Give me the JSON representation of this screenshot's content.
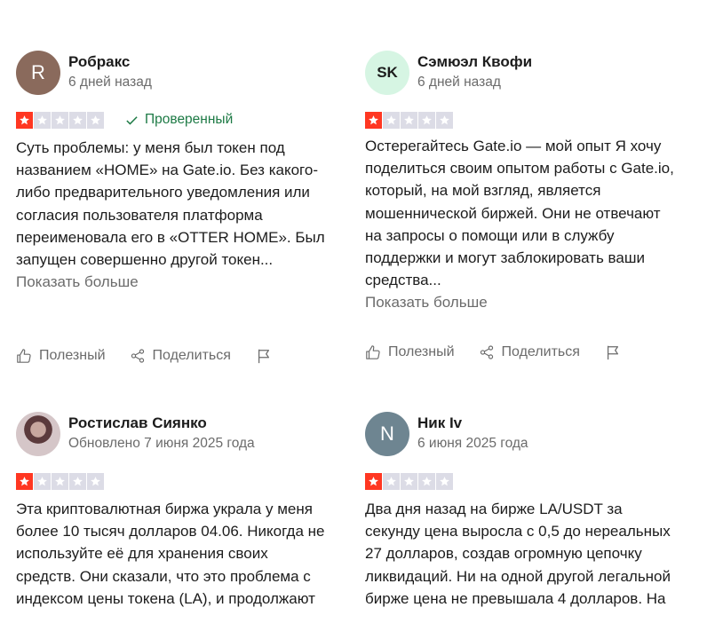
{
  "reviews": [
    {
      "name": "Робракс",
      "avatar_text": "R",
      "date": "6 дней назад",
      "rating": 1,
      "verified_label": "Проверенный",
      "text": "Суть проблемы: у меня был токен под названием «HOME» на Gate.io. Без какого-либо предварительного уведомления или согласия пользователя платформа переименовала его в «OTTER HOME». Был запущен совершенно другой токен...",
      "more_label": "Показать больше"
    },
    {
      "name": "Сэмюэл Квофи",
      "avatar_text": "SK",
      "date": "6 дней назад",
      "rating": 1,
      "text": "Остерегайтесь Gate.io — мой опыт Я хочу поделиться своим опытом работы с Gate.io, который, на мой взгляд, является мошеннической биржей. Они не отвечают на запросы о помощи или в службу поддержки и могут заблокировать ваши средства...",
      "more_label": "Показать больше"
    },
    {
      "name": "Ростислав Сиянко",
      "avatar_text": "",
      "date": "Обновлено 7 июня 2025 года",
      "rating": 1,
      "text": "Эта криптовалютная биржа украла у меня более 10 тысяч долларов 04.06. Никогда не используйте её для хранения своих средств. Они сказали, что это проблема с индексом цены токена (LA), и продолжают"
    },
    {
      "name": "Ник Iv",
      "avatar_text": "N",
      "date": "6 июня 2025 года",
      "rating": 1,
      "text": "Два дня назад на бирже LA/USDT за секунду цена выросла с 0,5 до нереальных 27 долларов, создав огромную цепочку ликвидаций. Ни на одной другой легальной бирже цена не превышала 4 долларов. На"
    }
  ],
  "actions": {
    "useful_label": "Полезный",
    "share_label": "Поделиться"
  },
  "icons": {
    "useful": "thumbs-up-icon",
    "share": "share-icon",
    "flag": "flag-icon",
    "verified": "check-icon",
    "star": "star-icon"
  },
  "colors": {
    "star_on": "#ff3722",
    "star_off": "#dcdce6",
    "verified": "#1d7a45"
  }
}
